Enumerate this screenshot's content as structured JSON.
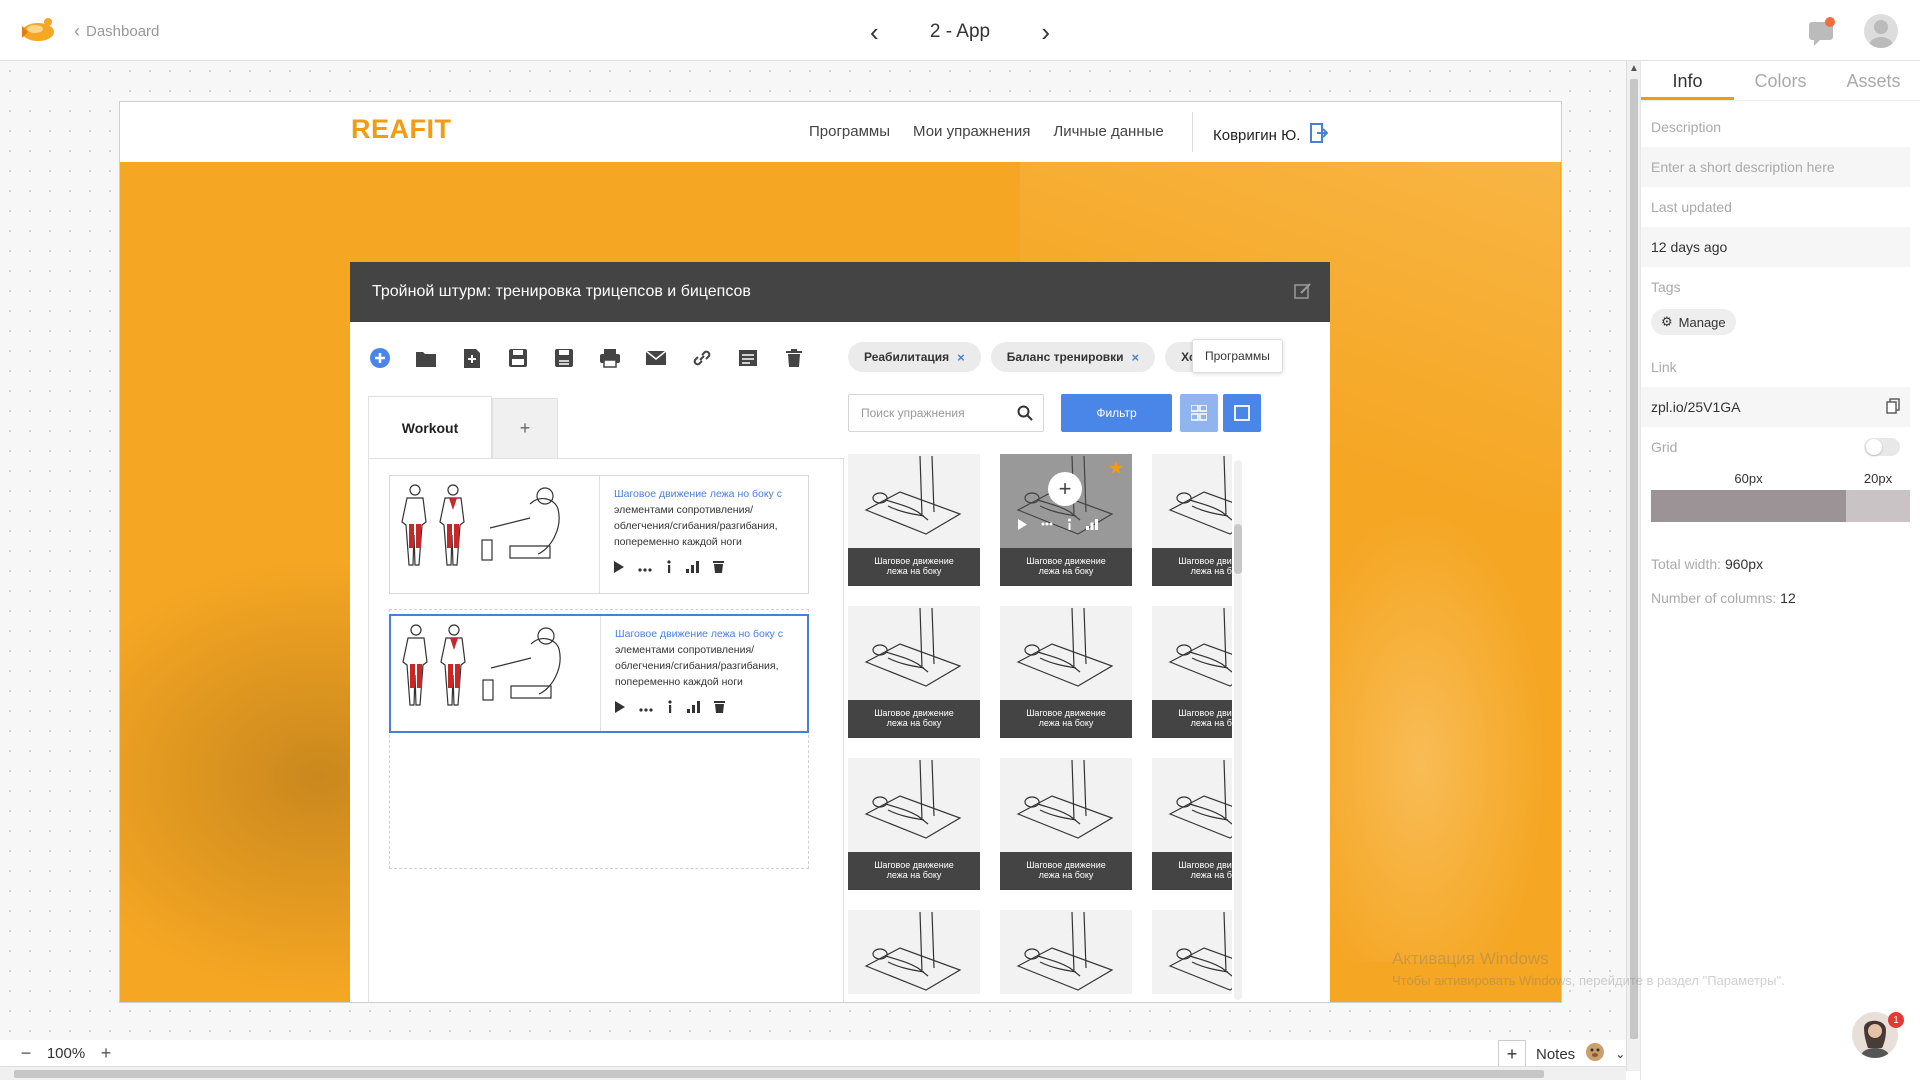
{
  "topbar": {
    "back_label": "Dashboard",
    "page_title": "2 - App",
    "prev_label": "‹",
    "next_label": "›"
  },
  "app": {
    "brand": "REAFIT",
    "menu": [
      "Программы",
      "Мои упражнения",
      "Личные данные"
    ],
    "user_name": "Ковригин Ю."
  },
  "modal": {
    "title": "Тройной штурм: тренировка трицепсов и бицепсов",
    "toolbar_icons": [
      "add-icon",
      "folder-icon",
      "new-document-icon",
      "save-icon",
      "save-as-icon",
      "print-icon",
      "email-icon",
      "link-icon",
      "notes-icon",
      "trash-icon"
    ],
    "tags": [
      {
        "label": "Реабилитация",
        "remove": "×"
      },
      {
        "label": "Баланс тренировки",
        "remove": "×"
      },
      {
        "label": "Ход",
        "remove": ""
      }
    ],
    "tooltip": "Программы",
    "search_placeholder": "Поиск упражнения",
    "filter_label": "Фильтр",
    "tabs": {
      "active": "Workout",
      "add": "+"
    },
    "exercise_cards": [
      {
        "title_highlight": "Шаговое движение лежа но боку с",
        "description": "элементами сопротивления/ облегчения/сгибания/разгибания, попеременно каждой ноги"
      },
      {
        "title_highlight": "Шаговое движение лежа но боку с",
        "description": "элементами сопротивления/ облегчения/сгибания/разгибания, попеременно каждой ноги"
      }
    ],
    "library": {
      "caption_line1": "Шаговое движение",
      "caption_line2": "лежа на боку",
      "tiles": 12
    }
  },
  "sidepanel": {
    "tabs": [
      "Info",
      "Colors",
      "Assets"
    ],
    "description_label": "Description",
    "description_placeholder": "Enter a short description here",
    "last_updated_label": "Last updated",
    "last_updated_value": "12 days ago",
    "tags_label": "Tags",
    "manage_label": "Manage",
    "link_label": "Link",
    "link_value": "zpl.io/25V1GA",
    "grid_label": "Grid",
    "grid_col_label": "60px",
    "grid_gutter_label": "20px",
    "total_width_label": "Total width:",
    "total_width_value": "960px",
    "columns_label": "Number of columns:",
    "columns_value": "12"
  },
  "bottombar": {
    "zoom_minus": "−",
    "zoom_value": "100%",
    "zoom_plus": "+",
    "notes_label": "Notes",
    "notes_add": "+",
    "support_badge": "1"
  },
  "watermark": {
    "line1": "Активация Windows",
    "line2": "Чтобы активировать Windows, перейдите в раздел \"Параметры\"."
  },
  "colors": {
    "accent": "#f39c12",
    "primary": "#4a86e8",
    "hero": "#f5a623",
    "modal_header": "#444444"
  }
}
